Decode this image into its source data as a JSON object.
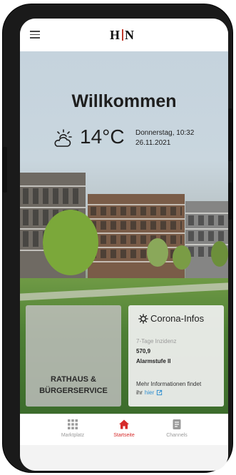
{
  "app": {
    "logo_text_left": "H",
    "logo_text_right": "N"
  },
  "hero": {
    "welcome": "Willkommen",
    "temperature": "14°C",
    "date_line1": "Donnerstag, 10:32",
    "date_line2": "26.11.2021",
    "weather_icon": "sun-cloud-icon"
  },
  "cards": {
    "left": {
      "title_line1": "RATHAUS &",
      "title_line2": "BÜRGERSERVICE"
    },
    "corona": {
      "title": "Corona-Infos",
      "incidence_label": "7-Tage Inzidenz",
      "incidence_value": "570,9",
      "alarm_level": "Alarmstufe II",
      "more_info_line1": "Mehr Informationen findet",
      "more_info_prefix": "ihr",
      "more_info_link": "hier",
      "icon": "virus-icon",
      "link_color": "#2f8fd0"
    }
  },
  "bottom_nav": {
    "items": [
      {
        "label": "Marktplatz",
        "icon": "grid-icon",
        "active": false
      },
      {
        "label": "Startseite",
        "icon": "home-icon",
        "active": true
      },
      {
        "label": "Channels",
        "icon": "document-icon",
        "active": false
      }
    ],
    "active_color": "#d62a2a",
    "inactive_color": "#9a9a9a"
  }
}
